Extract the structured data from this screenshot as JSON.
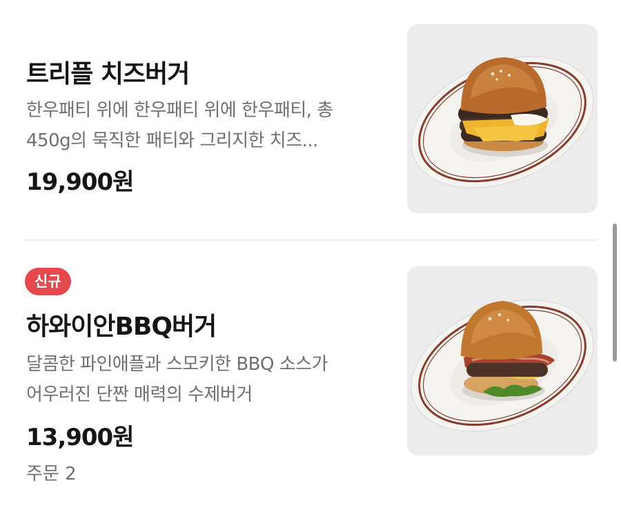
{
  "menu": [
    {
      "title": "트리플 치즈버거",
      "description_lines": [
        "한우패티 위에 한우패티 위에 한우패티, 총",
        "450g의 묵직한 패티와 그리지한 치즈..."
      ],
      "price": "19,900원",
      "image": "burger-photo"
    },
    {
      "badge": "신규",
      "title": "하와이안BBQ버거",
      "description_lines": [
        "달콤한 파인애플과 스모키한 BBQ 소스가",
        "어우러진 단짠 매력의 수제버거"
      ],
      "price": "13,900원",
      "orders": "주문 2",
      "image": "burger-photo"
    }
  ],
  "colors": {
    "badge": "#e5484d",
    "plate_rim": "#8a3a2a"
  }
}
